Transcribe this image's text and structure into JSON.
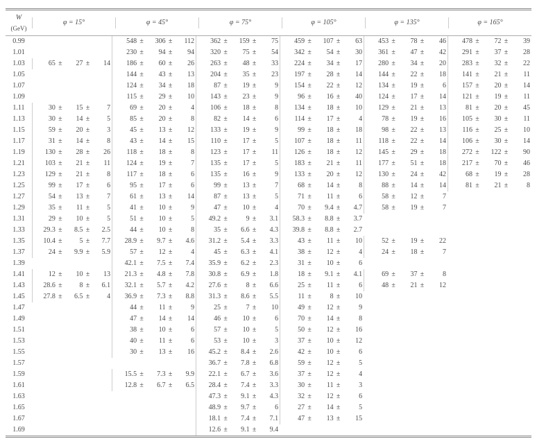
{
  "chart_data": {
    "type": "table",
    "title": "",
    "w_header": "W",
    "w_unit": "(GeV)",
    "phi_label": "φ",
    "phi_values_deg": [
      15,
      45,
      75,
      105,
      135,
      165
    ],
    "W": [
      0.99,
      1.01,
      1.03,
      1.05,
      1.07,
      1.09,
      1.11,
      1.13,
      1.15,
      1.17,
      1.19,
      1.21,
      1.23,
      1.25,
      1.27,
      1.29,
      1.31,
      1.33,
      1.35,
      1.37,
      1.39,
      1.41,
      1.43,
      1.45,
      1.47,
      1.49,
      1.51,
      1.53,
      1.55,
      1.57,
      1.59,
      1.61,
      1.63,
      1.65,
      1.67,
      1.69
    ],
    "columns": [
      [
        null,
        null,
        [
          65,
          27,
          14
        ],
        null,
        null,
        null,
        [
          30,
          15,
          7
        ],
        [
          30,
          14,
          5
        ],
        [
          59,
          20,
          3
        ],
        [
          31,
          14,
          8
        ],
        [
          130,
          28,
          26
        ],
        [
          103,
          21,
          11
        ],
        [
          129,
          21,
          8
        ],
        [
          99,
          17,
          6
        ],
        [
          54,
          13,
          7
        ],
        [
          35,
          11,
          5
        ],
        [
          29,
          10,
          5
        ],
        [
          29.3,
          8.5,
          2.5
        ],
        [
          10.4,
          5.0,
          7.7
        ],
        [
          24.0,
          9.9,
          5.9
        ],
        null,
        [
          12,
          10,
          13
        ],
        [
          28.6,
          8.0,
          6.1
        ],
        [
          27.8,
          6.5,
          4.0
        ],
        null,
        null,
        null,
        null,
        null,
        null,
        null,
        null,
        null,
        null,
        null,
        null
      ],
      [
        [
          548,
          306,
          112
        ],
        [
          230,
          94,
          94
        ],
        [
          186,
          60,
          26
        ],
        [
          144,
          43,
          13
        ],
        [
          124,
          34,
          18
        ],
        [
          115,
          29,
          10
        ],
        [
          69,
          20,
          4
        ],
        [
          85,
          20,
          8
        ],
        [
          45,
          13,
          12
        ],
        [
          43,
          14,
          15
        ],
        [
          118,
          18,
          8
        ],
        [
          124,
          19,
          7
        ],
        [
          117,
          18,
          6
        ],
        [
          95,
          17,
          6
        ],
        [
          61,
          13,
          14
        ],
        [
          41,
          10,
          9
        ],
        [
          51,
          10,
          5
        ],
        [
          44,
          10,
          8
        ],
        [
          28.9,
          9.7,
          4.6
        ],
        [
          57,
          12,
          4
        ],
        [
          42.1,
          7.5,
          7.4
        ],
        [
          21.3,
          4.8,
          7.8
        ],
        [
          32.1,
          5.7,
          4.2
        ],
        [
          36.9,
          7.3,
          8.8
        ],
        [
          44,
          11,
          9
        ],
        [
          47,
          14,
          14
        ],
        [
          38,
          10,
          6
        ],
        [
          40,
          11,
          6
        ],
        [
          30,
          13,
          16
        ],
        null,
        [
          15.5,
          7.3,
          9.9
        ],
        [
          12.8,
          6.7,
          6.5
        ],
        null,
        null,
        null,
        null
      ],
      [
        [
          362,
          159,
          75
        ],
        [
          320,
          75,
          54
        ],
        [
          263,
          48,
          33
        ],
        [
          204,
          35,
          23
        ],
        [
          87,
          19,
          9
        ],
        [
          143,
          23,
          9
        ],
        [
          106,
          18,
          8
        ],
        [
          82,
          14,
          6
        ],
        [
          133,
          19,
          9
        ],
        [
          110,
          17,
          5
        ],
        [
          123,
          17,
          11
        ],
        [
          135,
          17,
          5
        ],
        [
          135,
          16,
          9
        ],
        [
          99,
          13,
          7
        ],
        [
          87,
          13,
          5
        ],
        [
          47,
          10,
          4
        ],
        [
          49.2,
          9.0,
          3.1
        ],
        [
          35.0,
          6.6,
          4.3
        ],
        [
          31.2,
          5.4,
          3.3
        ],
        [
          45.0,
          6.3,
          4.1
        ],
        [
          35.9,
          6.2,
          2.3
        ],
        [
          30.8,
          6.9,
          1.8
        ],
        [
          27.6,
          8.0,
          6.6
        ],
        [
          31.3,
          8.6,
          5.5
        ],
        [
          25,
          7,
          10
        ],
        [
          46,
          10,
          6
        ],
        [
          57,
          10,
          5
        ],
        [
          53,
          10,
          3
        ],
        [
          45.2,
          8.4,
          2.6
        ],
        [
          36.7,
          7.8,
          6.8
        ],
        [
          22.1,
          6.7,
          3.6
        ],
        [
          28.4,
          7.4,
          3.3
        ],
        [
          47.3,
          9.1,
          4.3
        ],
        [
          48.9,
          9.7,
          6.0
        ],
        [
          18.1,
          7.4,
          7.1
        ],
        [
          12.6,
          9.1,
          9.4
        ]
      ],
      [
        [
          459,
          107,
          63
        ],
        [
          342,
          54,
          30
        ],
        [
          224,
          34,
          17
        ],
        [
          197,
          28,
          14
        ],
        [
          154,
          22,
          12
        ],
        [
          96,
          16,
          40
        ],
        [
          134,
          18,
          10
        ],
        [
          114,
          17,
          4
        ],
        [
          99,
          18,
          18
        ],
        [
          107,
          18,
          11
        ],
        [
          126,
          18,
          12
        ],
        [
          183,
          21,
          11
        ],
        [
          133,
          20,
          12
        ],
        [
          68,
          14,
          8
        ],
        [
          71,
          11,
          6
        ],
        [
          70.0,
          9.4,
          4.7
        ],
        [
          58.3,
          8.8,
          3.7
        ],
        [
          39.8,
          8.8,
          2.7
        ],
        [
          43,
          11,
          10
        ],
        [
          38,
          12,
          4
        ],
        [
          31,
          10,
          6
        ],
        [
          18.0,
          9.1,
          4.1
        ],
        [
          25,
          11,
          6
        ],
        [
          11,
          8,
          10
        ],
        [
          49,
          12,
          9
        ],
        [
          70,
          14,
          8
        ],
        [
          50,
          12,
          16
        ],
        [
          37,
          10,
          12
        ],
        [
          42,
          10,
          6
        ],
        [
          59,
          12,
          5
        ],
        [
          37,
          12,
          4
        ],
        [
          30,
          11,
          3
        ],
        [
          32,
          12,
          6
        ],
        [
          27,
          14,
          5
        ],
        [
          47,
          13,
          15
        ],
        null
      ],
      [
        [
          453,
          78,
          46
        ],
        [
          361,
          47,
          42
        ],
        [
          280,
          34,
          20
        ],
        [
          144,
          22,
          18
        ],
        [
          134,
          19,
          6
        ],
        [
          124,
          17,
          14
        ],
        [
          129,
          21,
          13
        ],
        [
          78,
          19,
          16
        ],
        [
          98,
          22,
          13
        ],
        [
          118,
          22,
          14
        ],
        [
          145,
          29,
          18
        ],
        [
          177,
          51,
          18
        ],
        [
          130,
          24,
          42
        ],
        [
          88,
          14,
          14
        ],
        [
          58,
          12,
          7
        ],
        [
          58,
          19,
          7
        ],
        null,
        null,
        [
          52,
          19,
          22
        ],
        [
          24,
          18,
          7
        ],
        null,
        [
          69,
          37,
          8
        ],
        [
          48,
          21,
          12
        ],
        null,
        null,
        null,
        null,
        null,
        null,
        null,
        null,
        null,
        null,
        null,
        null,
        null
      ],
      [
        [
          478,
          72,
          39
        ],
        [
          291,
          37,
          28
        ],
        [
          283,
          32,
          22
        ],
        [
          141,
          21,
          11
        ],
        [
          157,
          20,
          14
        ],
        [
          121,
          19,
          11
        ],
        [
          81,
          20,
          45
        ],
        [
          105,
          30,
          11
        ],
        [
          116,
          25,
          10
        ],
        [
          106,
          30,
          14
        ],
        [
          272,
          122,
          90
        ],
        [
          217,
          70,
          46
        ],
        [
          68,
          19,
          28
        ],
        [
          81,
          21,
          8
        ],
        null,
        null,
        null,
        null,
        null,
        null,
        null,
        null,
        null,
        null,
        null,
        null,
        null,
        null,
        null,
        null,
        null,
        null,
        null,
        null,
        null,
        null
      ]
    ]
  }
}
